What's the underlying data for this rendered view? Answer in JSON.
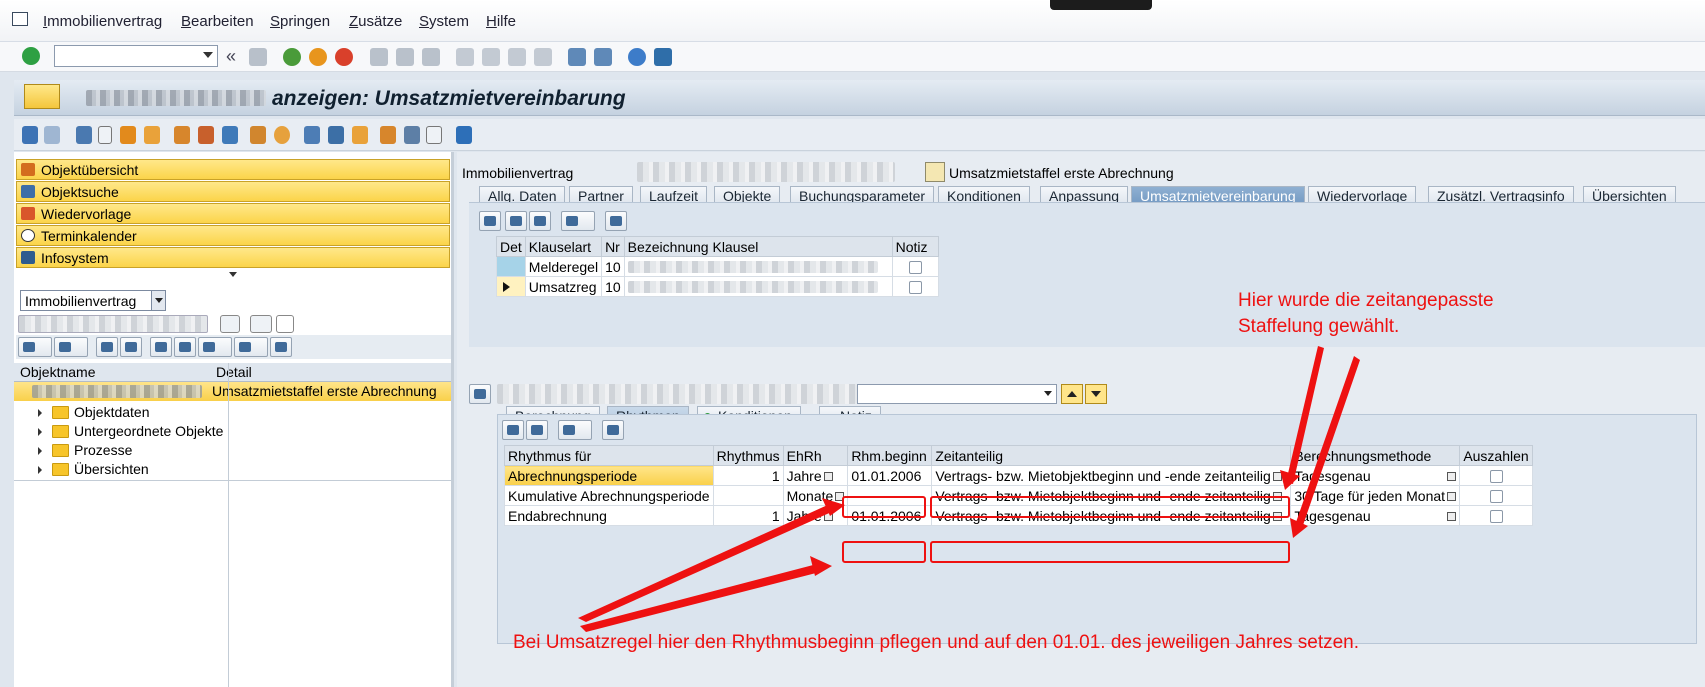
{
  "menubar": {
    "items": [
      "Immobilienvertrag",
      "Bearbeiten",
      "Springen",
      "Zusätze",
      "System",
      "Hilfe"
    ]
  },
  "title": "anzeigen: Umsatzmietvereinbarung",
  "left": {
    "nav": [
      "Objektübersicht",
      "Objektsuche",
      "Wiedervorlage",
      "Terminkalender",
      "Infosystem"
    ],
    "select_value": "Immobilienvertrag",
    "tree_headers": [
      "Objektname",
      "Detail"
    ],
    "selected_detail": "Umsatzmietstaffel erste Abrechnung",
    "tree_items": [
      "Objektdaten",
      "Untergeordnete Objekte",
      "Prozesse",
      "Übersichten"
    ]
  },
  "header": {
    "label": "Immobilienvertrag",
    "contract_desc": "Umsatzmietstaffel erste Abrechnung"
  },
  "tabs": [
    "Allg. Daten",
    "Partner",
    "Laufzeit",
    "Objekte",
    "Buchungsparameter",
    "Konditionen",
    "Anpassung",
    "Umsatzmietvereinbarung",
    "Wiedervorlage",
    "Zusätzl. Vertragsinfo",
    "Übersichten"
  ],
  "clause_table": {
    "headers": [
      "Det",
      "Klauselart",
      "Nr",
      "Bezeichnung Klausel",
      "Notiz"
    ],
    "rows": [
      {
        "type": "Melderegel",
        "nr": "10"
      },
      {
        "type": "Umsatzreg",
        "nr": "10"
      }
    ]
  },
  "subtabs": [
    "Berechnung",
    "Rhythmen",
    "Konditionen",
    "Notiz"
  ],
  "rhythm_table": {
    "headers": [
      "Rhythmus für",
      "Rhythmus",
      "EhRh",
      "Rhm.beginn",
      "Zeitanteilig",
      "Berechnungsmethode",
      "Auszahlen"
    ],
    "rows": [
      {
        "for": "Abrechnungsperiode",
        "rhythm": "1",
        "unit": "Jahre",
        "begin": "01.01.2006",
        "share": "Vertrags- bzw. Mietobjektbeginn und -ende zeitanteilig",
        "method": "Tagesgenau"
      },
      {
        "for": "Kumulative Abrechnungsperiode",
        "rhythm": "",
        "unit": "Monate",
        "begin": "",
        "share": "Vertrags- bzw. Mietobjektbeginn und -ende zeitanteilig",
        "method": "30 Tage für jeden Monat"
      },
      {
        "for": "Endabrechnung",
        "rhythm": "1",
        "unit": "Jahre",
        "begin": "01.01.2006",
        "share": "Vertrags- bzw. Mietobjektbeginn und -ende zeitanteilig",
        "method": "Tagesgenau"
      }
    ]
  },
  "annotations": {
    "top_line1": "Hier wurde die zeitangepasste",
    "top_line2": "Staffelung gewählt.",
    "bottom": "Bei Umsatzregel hier den Rhythmusbeginn pflegen und auf den 01.01. des jeweiligen Jahres setzen."
  },
  "colors": {
    "annotation": "#e11111",
    "selected": "#f9d04a",
    "active_tab": "#6f96c0"
  }
}
